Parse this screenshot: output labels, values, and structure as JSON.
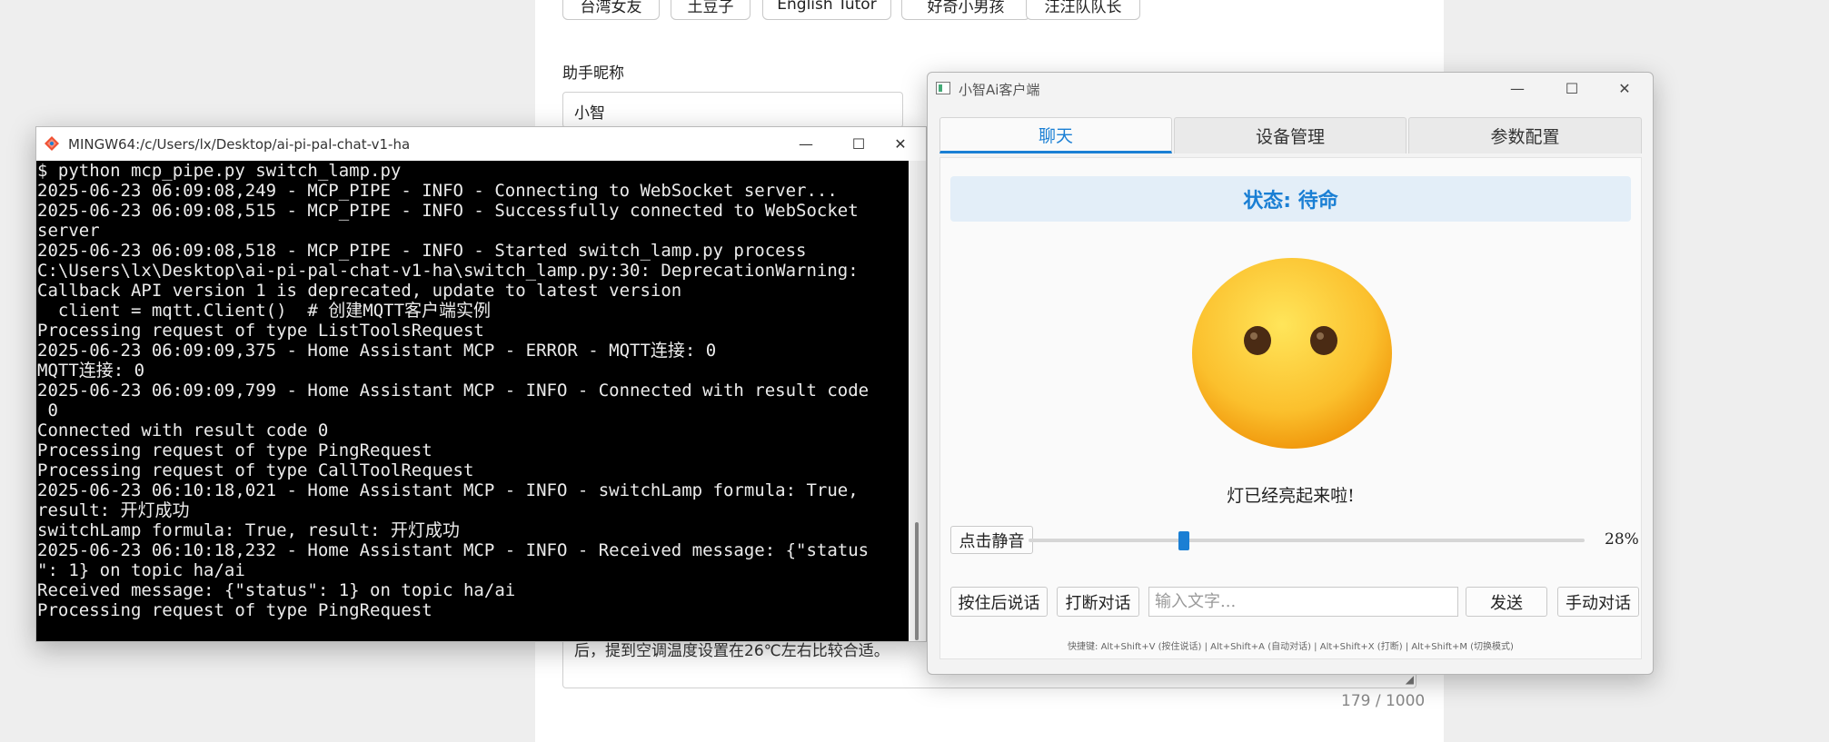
{
  "background_form": {
    "presets": [
      "台湾女友",
      "土豆子",
      "English Tutor",
      "好奇小男孩",
      "汪汪队队长"
    ],
    "assistant_name_label": "助手昵称",
    "assistant_name_value": "小智",
    "prompt_tail_text": "后，提到空调温度设置在26℃左右比较合适。",
    "char_count": "179 / 1000"
  },
  "terminal": {
    "title": "MINGW64:/c/Users/lx/Desktop/ai-pi-pal-chat-v1-ha",
    "lines": [
      "$ python mcp_pipe.py switch_lamp.py",
      "2025-06-23 06:09:08,249 - MCP_PIPE - INFO - Connecting to WebSocket server...",
      "2025-06-23 06:09:08,515 - MCP_PIPE - INFO - Successfully connected to WebSocket",
      "server",
      "2025-06-23 06:09:08,518 - MCP_PIPE - INFO - Started switch_lamp.py process",
      "C:\\Users\\lx\\Desktop\\ai-pi-pal-chat-v1-ha\\switch_lamp.py:30: DeprecationWarning:",
      "Callback API version 1 is deprecated, update to latest version",
      "  client = mqtt.Client()  # 创建MQTT客户端实例",
      "Processing request of type ListToolsRequest",
      "2025-06-23 06:09:09,375 - Home Assistant MCP - ERROR - MQTT连接: 0",
      "MQTT连接: 0",
      "2025-06-23 06:09:09,799 - Home Assistant MCP - INFO - Connected with result code",
      " 0",
      "Connected with result code 0",
      "Processing request of type PingRequest",
      "Processing request of type CallToolRequest",
      "2025-06-23 06:10:18,021 - Home Assistant MCP - INFO - switchLamp formula: True,",
      "result: 开灯成功",
      "switchLamp formula: True, result: 开灯成功",
      "2025-06-23 06:10:18,232 - Home Assistant MCP - INFO - Received message: {\"status",
      "\": 1} on topic ha/ai",
      "Received message: {\"status\": 1} on topic ha/ai",
      "Processing request of type PingRequest"
    ]
  },
  "client": {
    "title": "小智Ai客户端",
    "tabs": [
      "聊天",
      "设备管理",
      "参数配置"
    ],
    "active_tab": 0,
    "status_text": "状态: 待命",
    "emoji_icon": "neutral-face-icon",
    "message": "灯已经亮起来啦!",
    "mute_button": "点击静音",
    "volume_percent": 28,
    "volume_label": "28%",
    "buttons": {
      "push_to_talk": "按住后说话",
      "interrupt": "打断对话",
      "send": "发送",
      "manual": "手动对话"
    },
    "input_placeholder": "输入文字...",
    "shortcuts": "快捷键: Alt+Shift+V (按住说话) | Alt+Shift+A (自动对话) | Alt+Shift+X (打断) | Alt+Shift+M (切换模式)",
    "accent_color": "#1a7fd4"
  }
}
